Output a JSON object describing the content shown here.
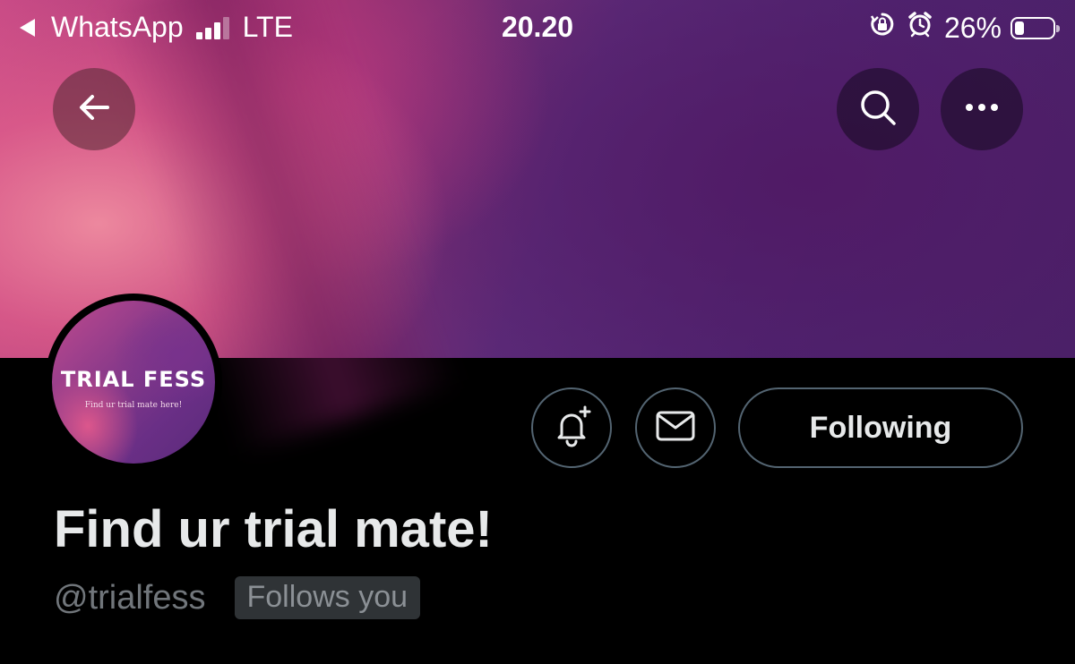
{
  "status_bar": {
    "back_app": "WhatsApp",
    "network": "LTE",
    "time": "20.20",
    "battery_percent": "26%",
    "battery_level": 0.26,
    "signal_bars": 3,
    "icons": [
      "orientation-lock-icon",
      "alarm-icon"
    ]
  },
  "header": {
    "back_icon": "arrow-left-icon",
    "search_icon": "search-icon",
    "more_icon": "more-horizontal-icon"
  },
  "profile": {
    "avatar": {
      "title": "TRIAL FESS",
      "subtitle": "Find ur trial mate here!"
    },
    "display_name": "Find ur trial mate!",
    "handle": "@trialfess",
    "follows_you_badge": "Follows you"
  },
  "actions": {
    "notify_icon": "bell-plus-icon",
    "message_icon": "envelope-icon",
    "following_label": "Following"
  },
  "colors": {
    "background": "#000000",
    "text_primary": "#e7e9ea",
    "text_secondary": "#71767b",
    "button_border": "#536471",
    "badge_bg": "#2f3336"
  }
}
